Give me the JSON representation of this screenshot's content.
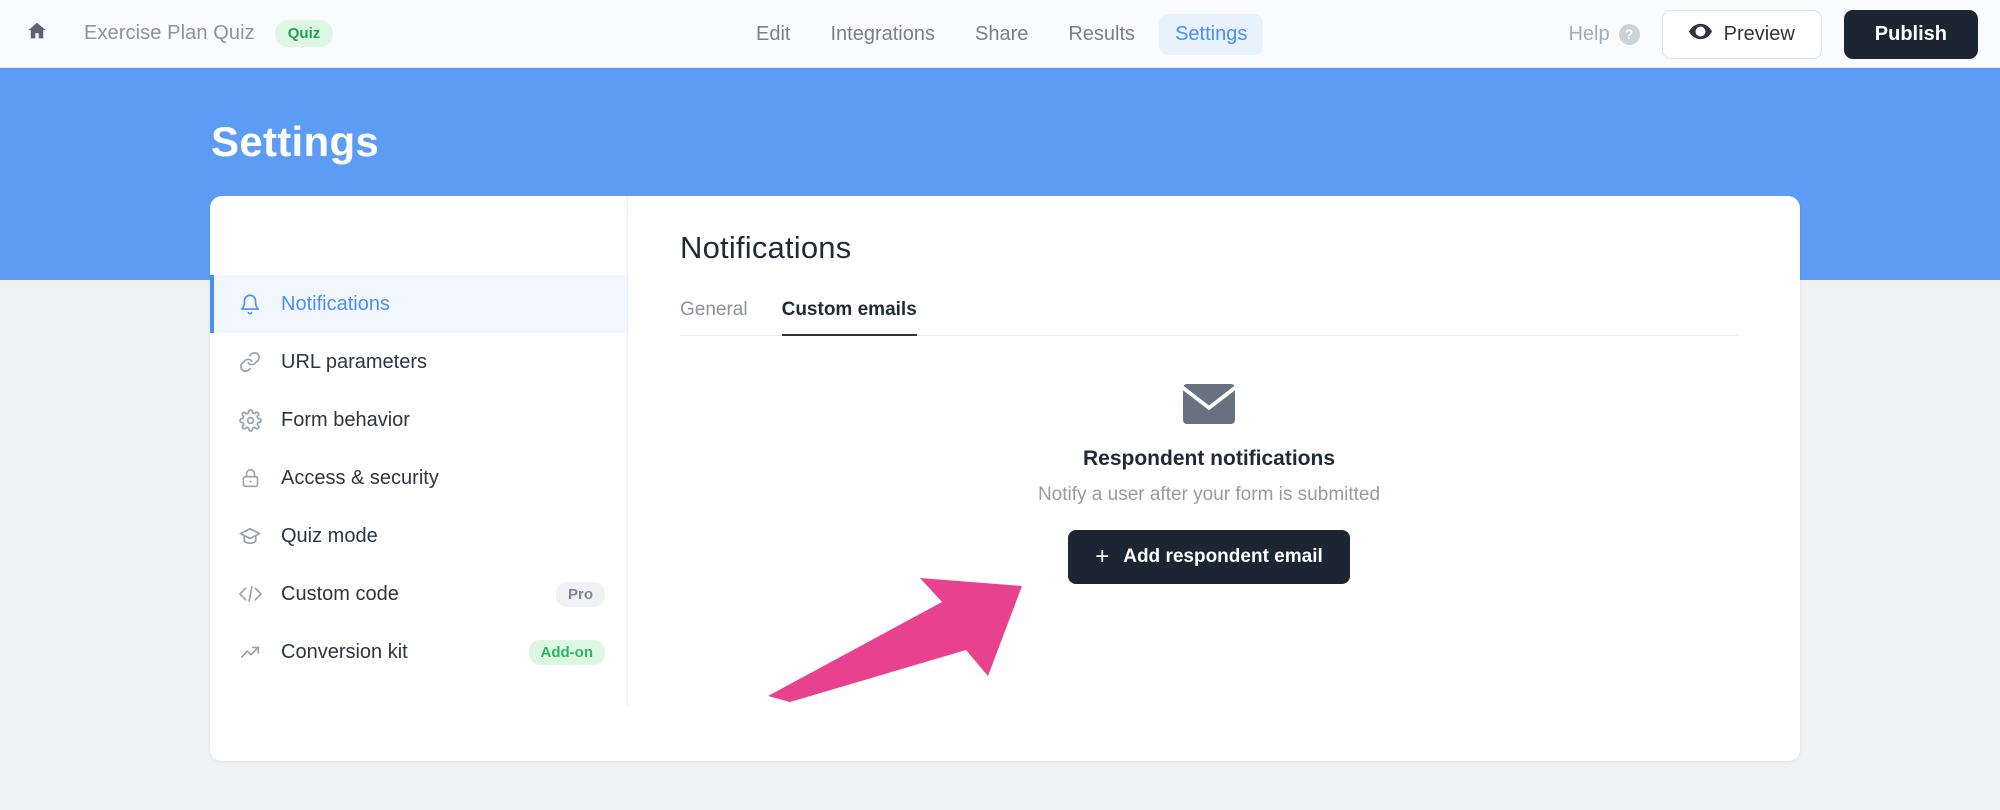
{
  "header": {
    "home_icon": "home-icon",
    "form_title": "Exercise Plan Quiz",
    "type_badge": "Quiz",
    "nav": [
      {
        "label": "Edit",
        "active": false
      },
      {
        "label": "Integrations",
        "active": false
      },
      {
        "label": "Share",
        "active": false
      },
      {
        "label": "Results",
        "active": false
      },
      {
        "label": "Settings",
        "active": true
      }
    ],
    "help_label": "Help",
    "help_icon": "question-mark-circle-icon",
    "preview_label": "Preview",
    "preview_icon": "eye-icon",
    "publish_label": "Publish"
  },
  "banner": {
    "title": "Settings",
    "color": "#5c9cf5"
  },
  "sidebar": {
    "items": [
      {
        "label": "Notifications",
        "icon": "bell-icon",
        "active": true,
        "badge": ""
      },
      {
        "label": "URL parameters",
        "icon": "link-icon",
        "active": false,
        "badge": ""
      },
      {
        "label": "Form behavior",
        "icon": "gear-icon",
        "active": false,
        "badge": ""
      },
      {
        "label": "Access & security",
        "icon": "lock-icon",
        "active": false,
        "badge": ""
      },
      {
        "label": "Quiz mode",
        "icon": "graduation-cap-icon",
        "active": false,
        "badge": ""
      },
      {
        "label": "Custom code",
        "icon": "code-brackets-icon",
        "active": false,
        "badge": "Pro"
      },
      {
        "label": "Conversion kit",
        "icon": "trending-up-icon",
        "active": false,
        "badge": "Add-on"
      }
    ]
  },
  "main": {
    "title": "Notifications",
    "tabs": [
      {
        "label": "General",
        "active": false
      },
      {
        "label": "Custom emails",
        "active": true
      }
    ],
    "empty_state": {
      "icon": "envelope-icon",
      "title": "Respondent notifications",
      "subtitle": "Notify a user after your form is submitted",
      "button_label": "Add respondent email",
      "button_icon": "plus-icon"
    }
  },
  "annotation": {
    "arrow_color": "#e8428f",
    "points_to": "Add respondent email"
  }
}
